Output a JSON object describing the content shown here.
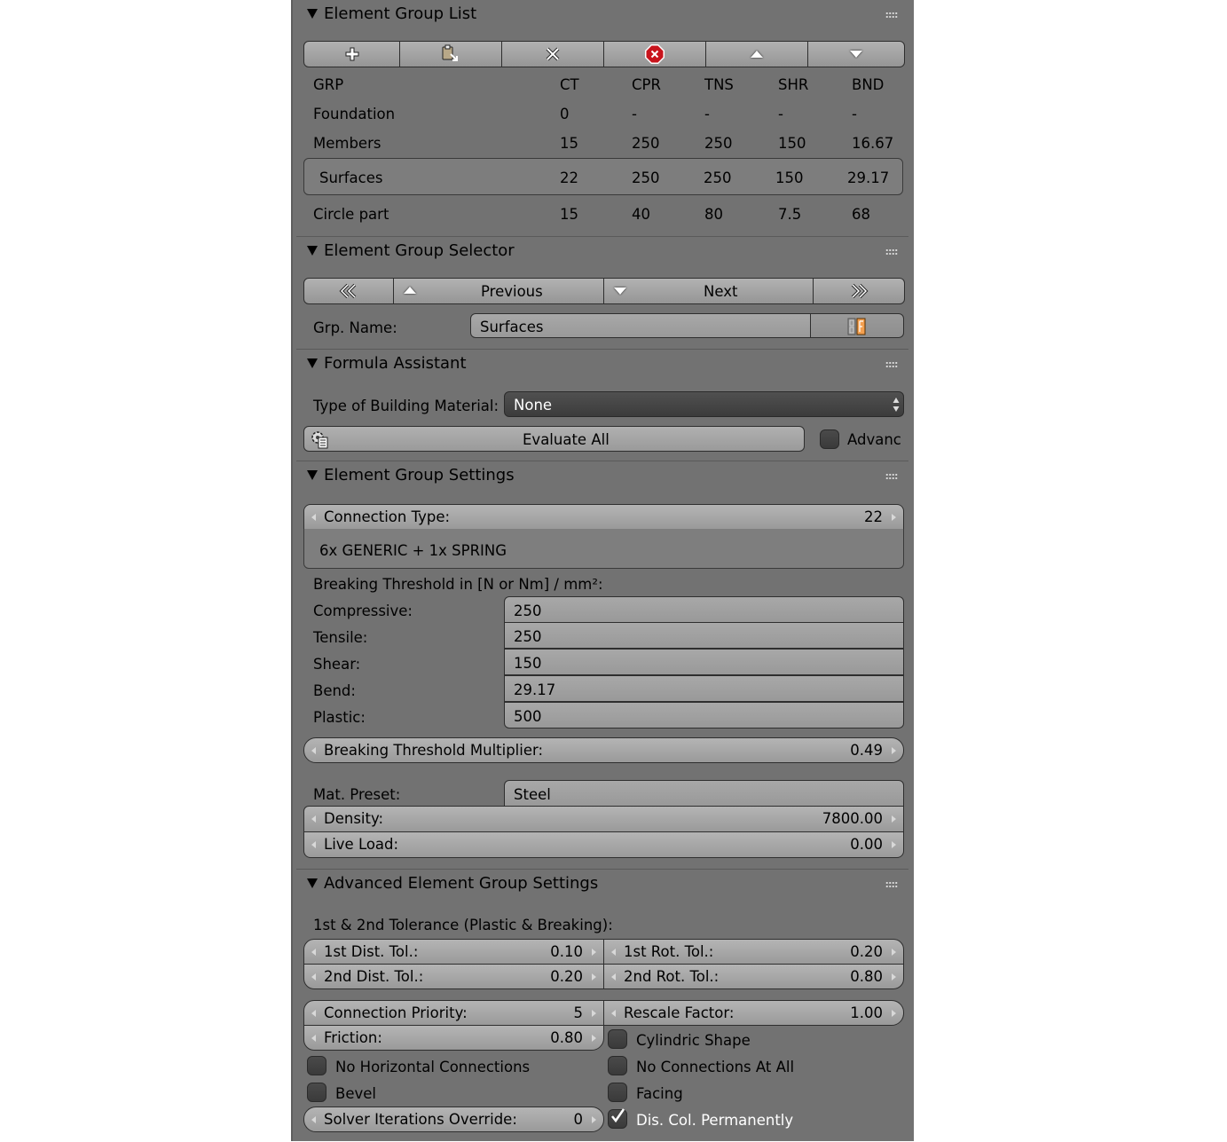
{
  "group_list": {
    "title": "Element Group List",
    "toolbar": [
      {
        "icon": "plus-icon"
      },
      {
        "icon": "paste-icon"
      },
      {
        "icon": "remove-icon"
      },
      {
        "icon": "remove-all-icon"
      },
      {
        "icon": "move-up-icon"
      },
      {
        "icon": "move-down-icon"
      }
    ],
    "columns": [
      "GRP",
      "CT",
      "CPR",
      "TNS",
      "SHR",
      "BND"
    ],
    "rows": [
      {
        "name": "Foundation",
        "ct": "0",
        "cpr": "-",
        "tns": "-",
        "shr": "-",
        "bnd": "-"
      },
      {
        "name": "Members",
        "ct": "15",
        "cpr": "250",
        "tns": "250",
        "shr": "150",
        "bnd": "16.67"
      },
      {
        "name": "Surfaces",
        "ct": "22",
        "cpr": "250",
        "tns": "250",
        "shr": "150",
        "bnd": "29.17",
        "selected": true
      },
      {
        "name": "Circle part",
        "ct": "15",
        "cpr": "40",
        "tns": "80",
        "shr": "7.5",
        "bnd": "68"
      }
    ]
  },
  "group_selector": {
    "title": "Element Group Selector",
    "previous_label": "Previous",
    "next_label": "Next",
    "grp_name_label": "Grp. Name:",
    "grp_name_value": "Surfaces"
  },
  "formula": {
    "title": "Formula Assistant",
    "material_label": "Type of Building Material:",
    "material_value": "None",
    "evaluate_label": "Evaluate All",
    "advanced_label": "Advanc",
    "advanced_checked": false
  },
  "settings": {
    "title": "Element Group Settings",
    "connection_type_label": "Connection Type:",
    "connection_type_value": "22",
    "connection_desc": "6x GENERIC + 1x SPRING",
    "threshold_heading": "Breaking Threshold in [N or Nm] / mm²:",
    "thresholds": [
      {
        "label": "Compressive:",
        "value": "250"
      },
      {
        "label": "Tensile:",
        "value": "250"
      },
      {
        "label": "Shear:",
        "value": "150"
      },
      {
        "label": "Bend:",
        "value": "29.17"
      },
      {
        "label": "Plastic:",
        "value": "500"
      }
    ],
    "multiplier_label": "Breaking Threshold Multiplier:",
    "multiplier_value": "0.49",
    "mat_preset_label": "Mat. Preset:",
    "mat_preset_value": "Steel",
    "density_label": "Density:",
    "density_value": "7800.00",
    "live_load_label": "Live Load:",
    "live_load_value": "0.00"
  },
  "advanced": {
    "title": "Advanced Element Group Settings",
    "tolerance_heading": "1st & 2nd Tolerance (Plastic & Breaking):",
    "dist_tol_1_label": "1st Dist. Tol.:",
    "dist_tol_1_value": "0.10",
    "rot_tol_1_label": "1st Rot. Tol.:",
    "rot_tol_1_value": "0.20",
    "dist_tol_2_label": "2nd Dist. Tol.:",
    "dist_tol_2_value": "0.20",
    "rot_tol_2_label": "2nd Rot. Tol.:",
    "rot_tol_2_value": "0.80",
    "priority_label": "Connection Priority:",
    "priority_value": "5",
    "rescale_label": "Rescale Factor:",
    "rescale_value": "1.00",
    "friction_label": "Friction:",
    "friction_value": "0.80",
    "cylindric_label": "Cylindric Shape",
    "no_horizontal_label": "No Horizontal Connections",
    "no_connections_label": "No Connections At All",
    "bevel_label": "Bevel",
    "facing_label": "Facing",
    "solver_label": "Solver Iterations Override:",
    "solver_value": "0",
    "dis_col_label": "Dis. Col. Permanently",
    "dis_col_checked": true
  }
}
